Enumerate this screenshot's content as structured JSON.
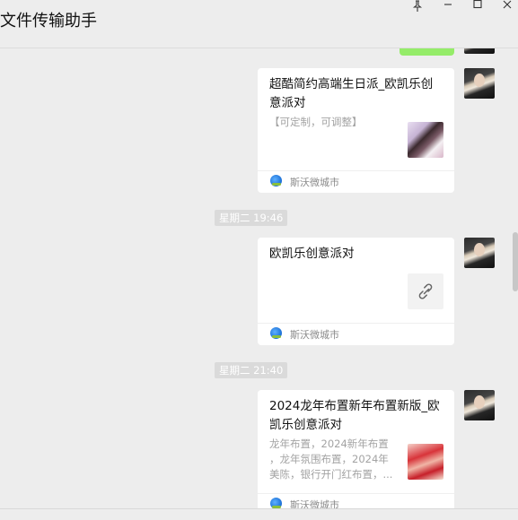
{
  "window": {
    "title": "文件传输助手",
    "pin_icon": "pin-icon",
    "minimize_icon": "minimize-icon",
    "maximize_icon": "maximize-icon",
    "close_icon": "close-icon"
  },
  "messages": [
    {
      "type": "link-card",
      "title": "超酷简约高端生日派_欧凯乐创意派对",
      "description": "【可定制，可调整】",
      "source": "斯沃微城市",
      "thumbnail": "party-photo"
    },
    {
      "type": "timestamp",
      "text": "星期二 19:46"
    },
    {
      "type": "link-card",
      "title": "欧凯乐创意派对",
      "description": "",
      "source": "斯沃微城市",
      "thumbnail": "link-icon"
    },
    {
      "type": "timestamp",
      "text": "星期二 21:40"
    },
    {
      "type": "link-card",
      "title": "2024龙年布置新年布置新版_欧凯乐创意派对",
      "description_lines": [
        "龙年布置，2024新年布置",
        "，龙年氛围布置，2024年",
        "美陈，银行开门红布置，..."
      ],
      "source": "斯沃微城市",
      "thumbnail": "newyear-photo"
    }
  ],
  "colors": {
    "sent_bubble": "#95ec69",
    "chat_bg": "#ededed",
    "card_bg": "#ffffff"
  }
}
